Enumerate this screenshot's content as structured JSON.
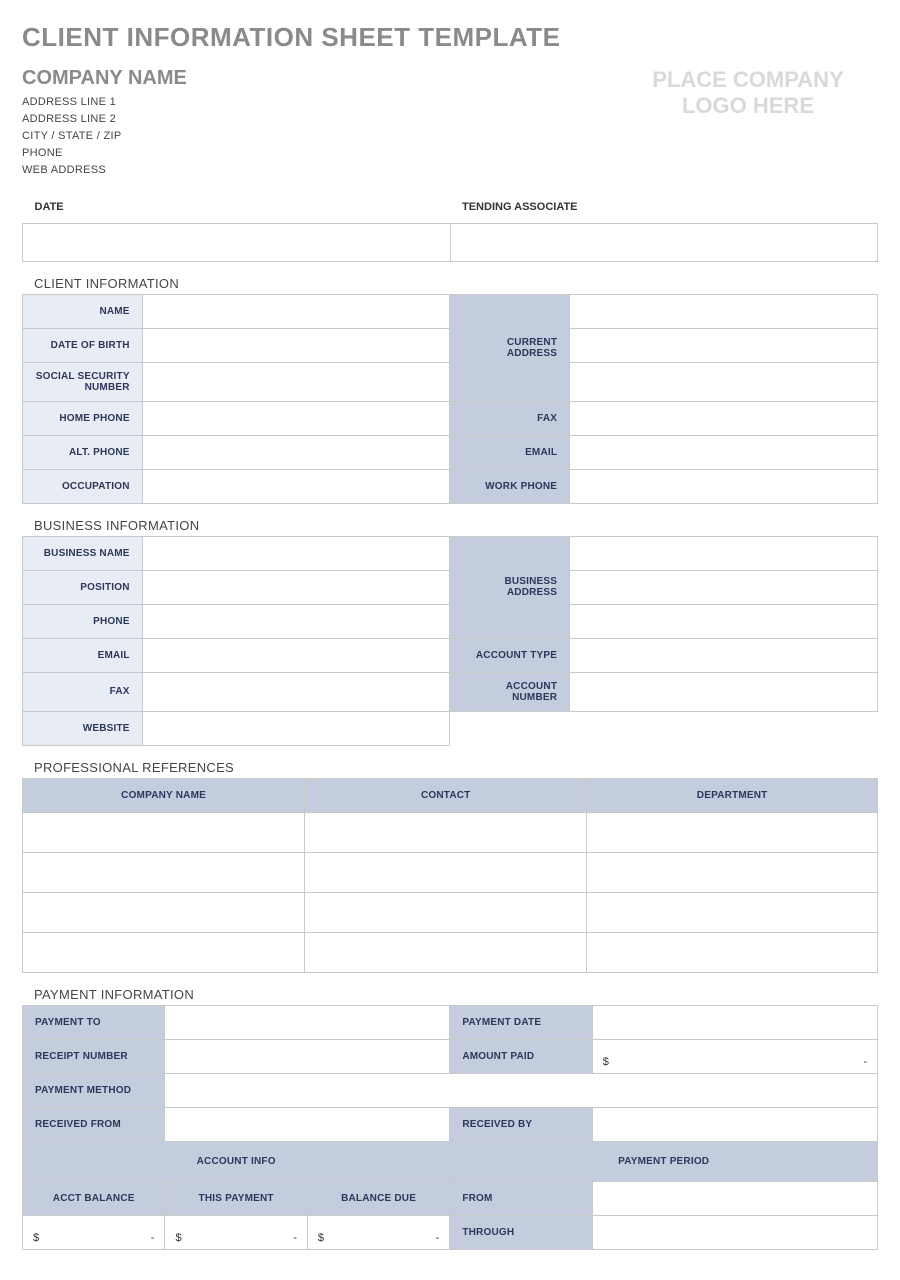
{
  "page_title": "CLIENT INFORMATION SHEET TEMPLATE",
  "company": {
    "name": "COMPANY NAME",
    "address1": "ADDRESS LINE 1",
    "address2": "ADDRESS LINE 2",
    "city_state_zip": "CITY / STATE / ZIP",
    "phone": "PHONE",
    "web": "WEB ADDRESS",
    "logo_placeholder_line1": "PLACE COMPANY",
    "logo_placeholder_line2": "LOGO HERE"
  },
  "date_row": {
    "date_label": "DATE",
    "associate_label": "TENDING ASSOCIATE",
    "date_value": "",
    "associate_value": ""
  },
  "client_info": {
    "section": "CLIENT INFORMATION",
    "labels": {
      "name": "NAME",
      "dob": "DATE OF BIRTH",
      "ssn": "SOCIAL SECURITY NUMBER",
      "current_address": "CURRENT ADDRESS",
      "home_phone": "HOME PHONE",
      "fax": "FAX",
      "alt_phone": "ALT. PHONE",
      "email": "EMAIL",
      "occupation": "OCCUPATION",
      "work_phone": "WORK PHONE"
    },
    "values": {
      "name": "",
      "dob": "",
      "ssn": "",
      "addr1": "",
      "addr2": "",
      "addr3": "",
      "home_phone": "",
      "fax": "",
      "alt_phone": "",
      "email": "",
      "occupation": "",
      "work_phone": ""
    }
  },
  "business_info": {
    "section": "BUSINESS INFORMATION",
    "labels": {
      "business_name": "BUSINESS NAME",
      "position": "POSITION",
      "phone": "PHONE",
      "business_address": "BUSINESS ADDRESS",
      "email": "EMAIL",
      "account_type": "ACCOUNT TYPE",
      "fax": "FAX",
      "account_number": "ACCOUNT NUMBER",
      "website": "WEBSITE"
    },
    "values": {
      "business_name": "",
      "position": "",
      "phone": "",
      "addr1": "",
      "addr2": "",
      "addr3": "",
      "email": "",
      "account_type": "",
      "fax": "",
      "account_number": "",
      "website": ""
    }
  },
  "references": {
    "section": "PROFESSIONAL REFERENCES",
    "headers": {
      "company": "COMPANY NAME",
      "contact": "CONTACT",
      "department": "DEPARTMENT"
    },
    "rows": [
      {
        "company": "",
        "contact": "",
        "department": ""
      },
      {
        "company": "",
        "contact": "",
        "department": ""
      },
      {
        "company": "",
        "contact": "",
        "department": ""
      },
      {
        "company": "",
        "contact": "",
        "department": ""
      }
    ]
  },
  "payment": {
    "section": "PAYMENT INFORMATION",
    "labels": {
      "payment_to": "PAYMENT TO",
      "payment_date": "PAYMENT DATE",
      "receipt_number": "RECEIPT NUMBER",
      "amount_paid": "AMOUNT PAID",
      "payment_method": "PAYMENT METHOD",
      "received_from": "RECEIVED FROM",
      "received_by": "RECEIVED BY",
      "account_info": "ACCOUNT INFO",
      "payment_period": "PAYMENT PERIOD",
      "acct_balance": "ACCT BALANCE",
      "this_payment": "THIS PAYMENT",
      "balance_due": "BALANCE DUE",
      "from": "FROM",
      "through": "THROUGH"
    },
    "values": {
      "payment_to": "",
      "payment_date": "",
      "receipt_number": "",
      "amount_symbol": "$",
      "amount_dash": "-",
      "payment_method": "",
      "received_from": "",
      "received_by": "",
      "from": "",
      "through": ""
    }
  }
}
